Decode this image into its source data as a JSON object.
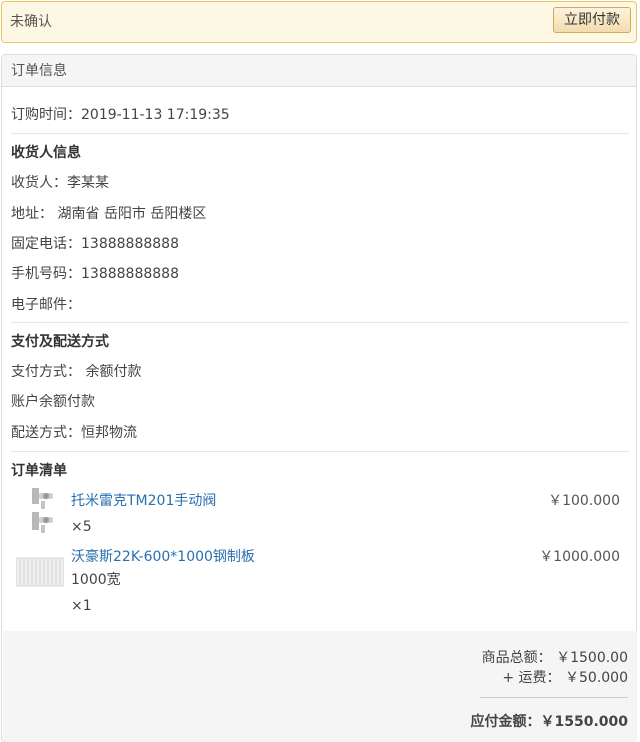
{
  "alert": {
    "status": "未确认",
    "pay_button": "立即付款"
  },
  "panel": {
    "title": "订单信息"
  },
  "order": {
    "time_label": "订购时间：",
    "time": "2019-11-13 17:19:35"
  },
  "consignee": {
    "heading": "收货人信息",
    "name_line": "收货人：李某某",
    "address_line": "地址： 湖南省 岳阳市 岳阳楼区",
    "phone_line": "固定电话：13888888888",
    "mobile_line": "手机号码：13888888888",
    "email_line": "电子邮件："
  },
  "payment": {
    "heading": "支付及配送方式",
    "method_line": "支付方式： 余额付款",
    "balance_line": "账户余额付款",
    "shipping_line": "配送方式：恒邦物流"
  },
  "items_section": {
    "heading": "订单清单",
    "items": [
      {
        "name": "托米雷克TM201手动阀",
        "price": "￥100.000",
        "spec": "",
        "qty": "×5"
      },
      {
        "name": "沃豪斯22K-600*1000钢制板",
        "price": "￥1000.000",
        "spec": "1000宽",
        "qty": "×1"
      }
    ]
  },
  "summary": {
    "subtotal_line": "商品总额： ￥1500.00",
    "shipping_line": "+ 运费：  ￥50.000",
    "total_line": "应付金额：￥1550.000"
  }
}
